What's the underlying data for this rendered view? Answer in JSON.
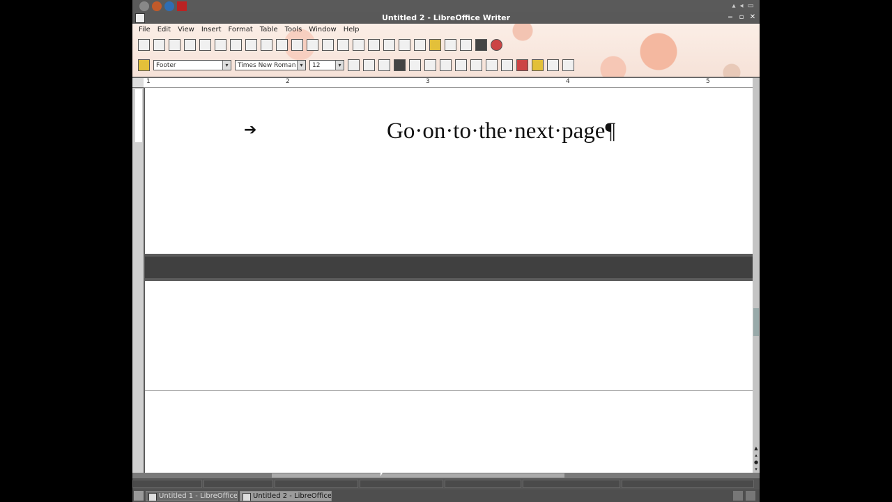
{
  "window": {
    "title": "Untitled 2 - LibreOffice Writer",
    "buttons": [
      "‒",
      "▫",
      "✕"
    ]
  },
  "menubar": {
    "items": [
      "File",
      "Edit",
      "View",
      "Insert",
      "Format",
      "Table",
      "Tools",
      "Window",
      "Help"
    ]
  },
  "formatting": {
    "paragraph_style": "Footer",
    "font_name": "Times New Roman",
    "font_size": "12"
  },
  "ruler": {
    "numbers": [
      "1",
      "2",
      "3",
      "4",
      "5"
    ]
  },
  "document": {
    "tab_marker": "➔",
    "footer_text": "Go·on·to·the·next·page¶"
  },
  "taskbar": {
    "tasks": [
      {
        "label": "Untitled 1 - LibreOffice..."
      },
      {
        "label": "Untitled 2 - LibreOffice..."
      }
    ]
  }
}
